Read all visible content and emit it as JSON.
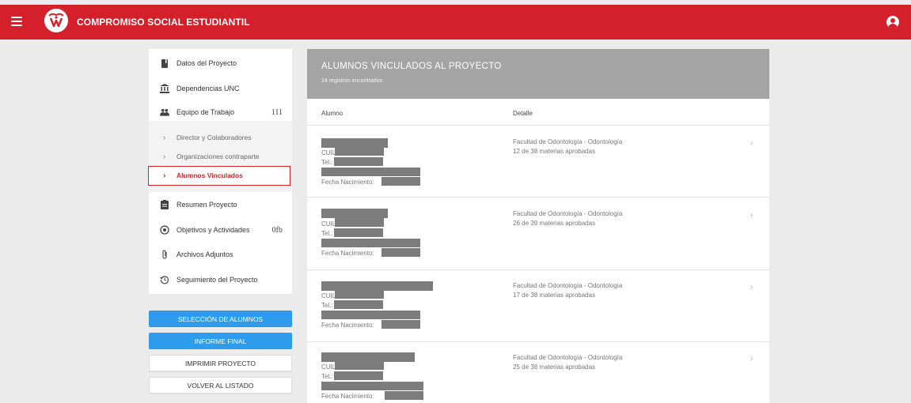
{
  "app": {
    "title": "COMPROMISO SOCIAL ESTUDIANTIL"
  },
  "icons": {
    "menu": "hamburger-menu-icon",
    "logo": "app-logo-icon",
    "account": "account-circle-icon"
  },
  "colors": {
    "brand": "#d3202a",
    "primary_button": "#2d9cec",
    "panel_header": "#a4a4a4"
  },
  "sidebar": {
    "items": [
      {
        "label": "Datos del Proyecto",
        "icon": "book-icon"
      },
      {
        "label": "Dependencias UNC",
        "icon": "bank-icon"
      },
      {
        "label": "Equipo de Trabajo",
        "icon": "group-icon",
        "badge": "111"
      },
      {
        "label": "Resumen Proyecto",
        "icon": "clipboard-icon"
      },
      {
        "label": "Objetivos y Actividades",
        "icon": "radio-target-icon",
        "badge": "0fb"
      },
      {
        "label": "Archivos Adjuntos",
        "icon": "paperclip-icon"
      },
      {
        "label": "Seguimiento del Proyecto",
        "icon": "history-icon"
      }
    ],
    "sub_items": [
      {
        "label": "Director y Colaboradores"
      },
      {
        "label": "Organizaciones contraparte"
      },
      {
        "label": "Alumnos Vinculados"
      }
    ]
  },
  "buttons": {
    "seleccion": "SELECCIÓN DE ALUMNOS",
    "informe": "INFORME FINAL",
    "imprimir": "IMPRIMIR PROYECTO",
    "volver": "VOLVER AL LISTADO"
  },
  "panel": {
    "title": "ALUMNOS VINCULADOS AL PROYECTO",
    "subtitle": "24 registros encontrados",
    "col_alumno": "Alumno",
    "col_detalle": "Detalle"
  },
  "field_labels": {
    "cuil": "CUIL:",
    "tel": "Tel.:",
    "fecha": "Fecha Nacimiento:"
  },
  "students": [
    {
      "faculty": "Facultad de Odontología - Odontología",
      "materias": "12 de 38 materias aprobadas"
    },
    {
      "faculty": "Facultad de Odontología - Odontología",
      "materias": "26 de 39 materias aprobadas"
    },
    {
      "faculty": "Facultad de Odontología - Odontología",
      "materias": "17 de 38 materias aprobadas"
    },
    {
      "faculty": "Facultad de Odontología - Odontología",
      "materias": "25 de 38 materias aprobadas"
    }
  ]
}
